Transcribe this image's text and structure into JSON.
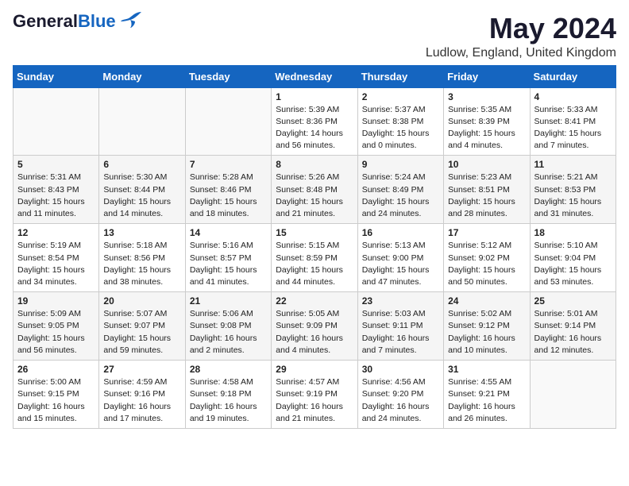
{
  "header": {
    "logo_general": "General",
    "logo_blue": "Blue",
    "title": "May 2024",
    "subtitle": "Ludlow, England, United Kingdom"
  },
  "weekdays": [
    "Sunday",
    "Monday",
    "Tuesday",
    "Wednesday",
    "Thursday",
    "Friday",
    "Saturday"
  ],
  "weeks": [
    [
      {
        "day": "",
        "info": ""
      },
      {
        "day": "",
        "info": ""
      },
      {
        "day": "",
        "info": ""
      },
      {
        "day": "1",
        "info": "Sunrise: 5:39 AM\nSunset: 8:36 PM\nDaylight: 14 hours\nand 56 minutes."
      },
      {
        "day": "2",
        "info": "Sunrise: 5:37 AM\nSunset: 8:38 PM\nDaylight: 15 hours\nand 0 minutes."
      },
      {
        "day": "3",
        "info": "Sunrise: 5:35 AM\nSunset: 8:39 PM\nDaylight: 15 hours\nand 4 minutes."
      },
      {
        "day": "4",
        "info": "Sunrise: 5:33 AM\nSunset: 8:41 PM\nDaylight: 15 hours\nand 7 minutes."
      }
    ],
    [
      {
        "day": "5",
        "info": "Sunrise: 5:31 AM\nSunset: 8:43 PM\nDaylight: 15 hours\nand 11 minutes."
      },
      {
        "day": "6",
        "info": "Sunrise: 5:30 AM\nSunset: 8:44 PM\nDaylight: 15 hours\nand 14 minutes."
      },
      {
        "day": "7",
        "info": "Sunrise: 5:28 AM\nSunset: 8:46 PM\nDaylight: 15 hours\nand 18 minutes."
      },
      {
        "day": "8",
        "info": "Sunrise: 5:26 AM\nSunset: 8:48 PM\nDaylight: 15 hours\nand 21 minutes."
      },
      {
        "day": "9",
        "info": "Sunrise: 5:24 AM\nSunset: 8:49 PM\nDaylight: 15 hours\nand 24 minutes."
      },
      {
        "day": "10",
        "info": "Sunrise: 5:23 AM\nSunset: 8:51 PM\nDaylight: 15 hours\nand 28 minutes."
      },
      {
        "day": "11",
        "info": "Sunrise: 5:21 AM\nSunset: 8:53 PM\nDaylight: 15 hours\nand 31 minutes."
      }
    ],
    [
      {
        "day": "12",
        "info": "Sunrise: 5:19 AM\nSunset: 8:54 PM\nDaylight: 15 hours\nand 34 minutes."
      },
      {
        "day": "13",
        "info": "Sunrise: 5:18 AM\nSunset: 8:56 PM\nDaylight: 15 hours\nand 38 minutes."
      },
      {
        "day": "14",
        "info": "Sunrise: 5:16 AM\nSunset: 8:57 PM\nDaylight: 15 hours\nand 41 minutes."
      },
      {
        "day": "15",
        "info": "Sunrise: 5:15 AM\nSunset: 8:59 PM\nDaylight: 15 hours\nand 44 minutes."
      },
      {
        "day": "16",
        "info": "Sunrise: 5:13 AM\nSunset: 9:00 PM\nDaylight: 15 hours\nand 47 minutes."
      },
      {
        "day": "17",
        "info": "Sunrise: 5:12 AM\nSunset: 9:02 PM\nDaylight: 15 hours\nand 50 minutes."
      },
      {
        "day": "18",
        "info": "Sunrise: 5:10 AM\nSunset: 9:04 PM\nDaylight: 15 hours\nand 53 minutes."
      }
    ],
    [
      {
        "day": "19",
        "info": "Sunrise: 5:09 AM\nSunset: 9:05 PM\nDaylight: 15 hours\nand 56 minutes."
      },
      {
        "day": "20",
        "info": "Sunrise: 5:07 AM\nSunset: 9:07 PM\nDaylight: 15 hours\nand 59 minutes."
      },
      {
        "day": "21",
        "info": "Sunrise: 5:06 AM\nSunset: 9:08 PM\nDaylight: 16 hours\nand 2 minutes."
      },
      {
        "day": "22",
        "info": "Sunrise: 5:05 AM\nSunset: 9:09 PM\nDaylight: 16 hours\nand 4 minutes."
      },
      {
        "day": "23",
        "info": "Sunrise: 5:03 AM\nSunset: 9:11 PM\nDaylight: 16 hours\nand 7 minutes."
      },
      {
        "day": "24",
        "info": "Sunrise: 5:02 AM\nSunset: 9:12 PM\nDaylight: 16 hours\nand 10 minutes."
      },
      {
        "day": "25",
        "info": "Sunrise: 5:01 AM\nSunset: 9:14 PM\nDaylight: 16 hours\nand 12 minutes."
      }
    ],
    [
      {
        "day": "26",
        "info": "Sunrise: 5:00 AM\nSunset: 9:15 PM\nDaylight: 16 hours\nand 15 minutes."
      },
      {
        "day": "27",
        "info": "Sunrise: 4:59 AM\nSunset: 9:16 PM\nDaylight: 16 hours\nand 17 minutes."
      },
      {
        "day": "28",
        "info": "Sunrise: 4:58 AM\nSunset: 9:18 PM\nDaylight: 16 hours\nand 19 minutes."
      },
      {
        "day": "29",
        "info": "Sunrise: 4:57 AM\nSunset: 9:19 PM\nDaylight: 16 hours\nand 21 minutes."
      },
      {
        "day": "30",
        "info": "Sunrise: 4:56 AM\nSunset: 9:20 PM\nDaylight: 16 hours\nand 24 minutes."
      },
      {
        "day": "31",
        "info": "Sunrise: 4:55 AM\nSunset: 9:21 PM\nDaylight: 16 hours\nand 26 minutes."
      },
      {
        "day": "",
        "info": ""
      }
    ]
  ]
}
